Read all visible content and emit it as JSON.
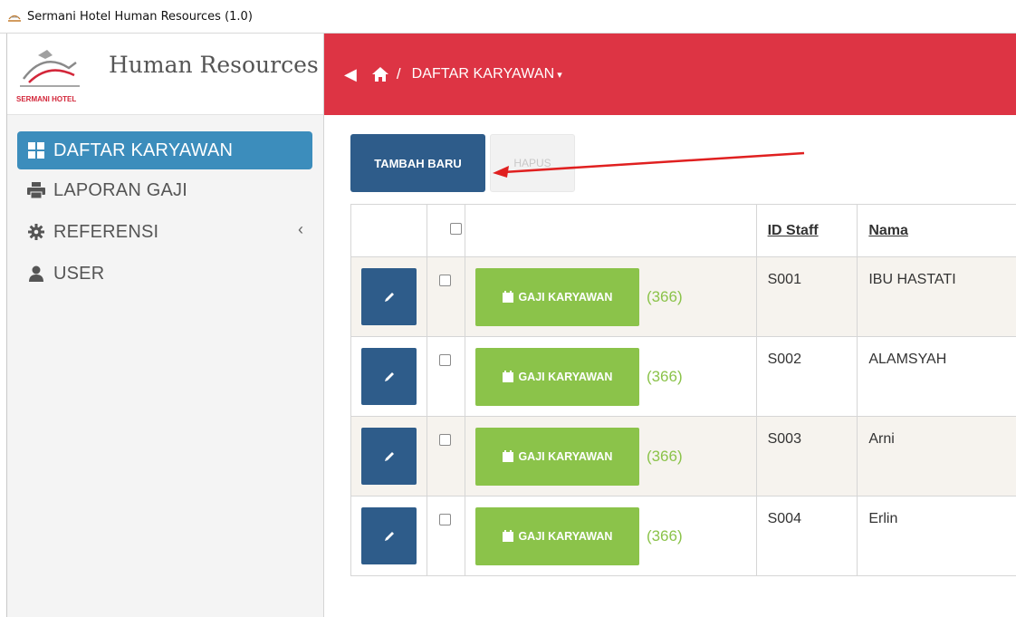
{
  "window": {
    "title": "Sermani Hotel Human Resources (1.0)"
  },
  "brand": {
    "logo_text": "SERMANI HOTEL",
    "name": "Human Resources"
  },
  "sidebar": {
    "items": [
      {
        "label": "DAFTAR KARYAWAN",
        "icon": "grid-icon",
        "active": true
      },
      {
        "label": "LAPORAN GAJI",
        "icon": "printer-icon",
        "active": false
      },
      {
        "label": "REFERENSI",
        "icon": "gear-icon",
        "active": false,
        "chevron": "‹"
      },
      {
        "label": "USER",
        "icon": "user-icon",
        "active": false
      }
    ]
  },
  "header": {
    "back": "◀",
    "separator": "/",
    "breadcrumb": "DAFTAR KARYAWAN",
    "breadcrumb_caret": "▾"
  },
  "toolbar": {
    "add_label": "TAMBAH BARU",
    "delete_label": "HAPUS"
  },
  "table": {
    "headers": {
      "id": "ID Staff",
      "name": "Nama"
    },
    "rows": [
      {
        "pay_label": "GAJI KARYAWAN",
        "count": "(366)",
        "id": "S001",
        "name": "IBU HASTATI"
      },
      {
        "pay_label": "GAJI KARYAWAN",
        "count": "(366)",
        "id": "S002",
        "name": "ALAMSYAH"
      },
      {
        "pay_label": "GAJI KARYAWAN",
        "count": "(366)",
        "id": "S003",
        "name": "Arni"
      },
      {
        "pay_label": "GAJI KARYAWAN",
        "count": "(366)",
        "id": "S004",
        "name": "Erlin"
      }
    ]
  },
  "colors": {
    "header_red": "#dd3444",
    "active_blue": "#3c8dbc",
    "button_navy": "#2e5c8a",
    "pay_green": "#8bc34a",
    "annotation_arrow": "#e02020"
  }
}
